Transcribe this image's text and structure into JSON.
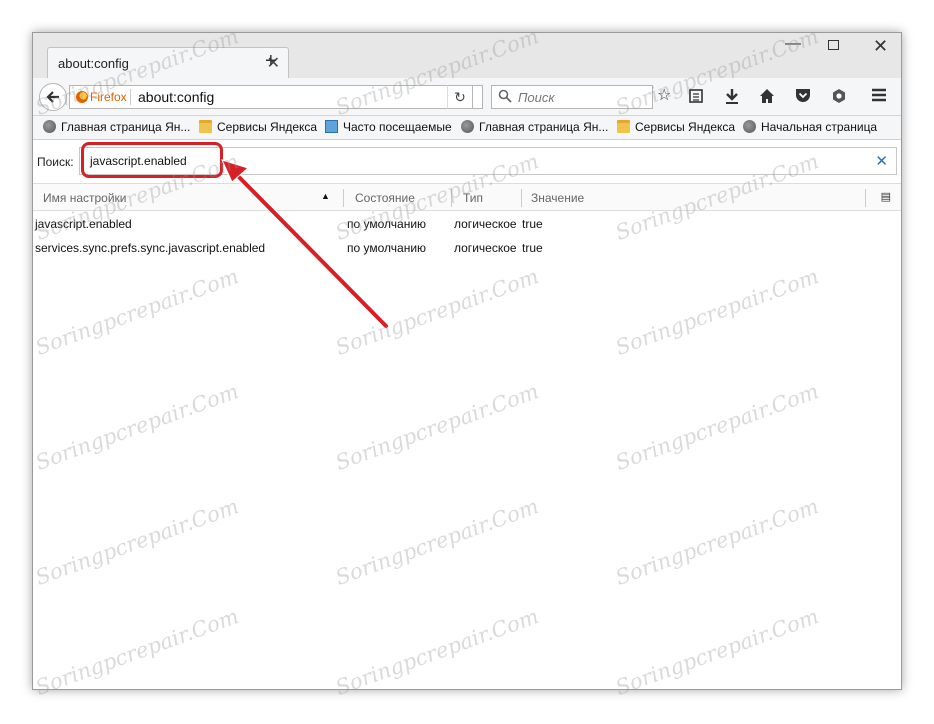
{
  "tab": {
    "title": "about:config",
    "close": "✕",
    "new_tab": "+"
  },
  "window_controls": {
    "minimize": "—",
    "close": "✕"
  },
  "navbar": {
    "identity_label": "Firefox",
    "url": "about:config",
    "search_placeholder": "Поиск"
  },
  "bookmarks": [
    {
      "label": "Главная страница Ян...",
      "icon": "globe-icon"
    },
    {
      "label": "Сервисы Яндекса",
      "icon": "folder-icon"
    },
    {
      "label": "Часто посещаемые",
      "icon": "smart-folder-icon"
    },
    {
      "label": "Главная страница Ян...",
      "icon": "globe-icon"
    },
    {
      "label": "Сервисы Яндекса",
      "icon": "folder-icon"
    },
    {
      "label": "Начальная страница",
      "icon": "globe-icon"
    }
  ],
  "config": {
    "search_label": "Поиск:",
    "search_value": "javascript.enabled"
  },
  "table": {
    "columns": [
      "Имя настройки",
      "Состояние",
      "Тип",
      "Значение"
    ],
    "rows": [
      {
        "name": "javascript.enabled",
        "state": "по умолчанию",
        "type": "логическое",
        "value": "true"
      },
      {
        "name": "services.sync.prefs.sync.javascript.enabled",
        "state": "по умолчанию",
        "type": "логическое",
        "value": "true"
      }
    ]
  },
  "watermark": "Soringpcrepair.Com",
  "colors": {
    "annotation_red": "#d71f26",
    "firefox_orange": "#e66000",
    "clear_blue": "#2f6fc0"
  }
}
